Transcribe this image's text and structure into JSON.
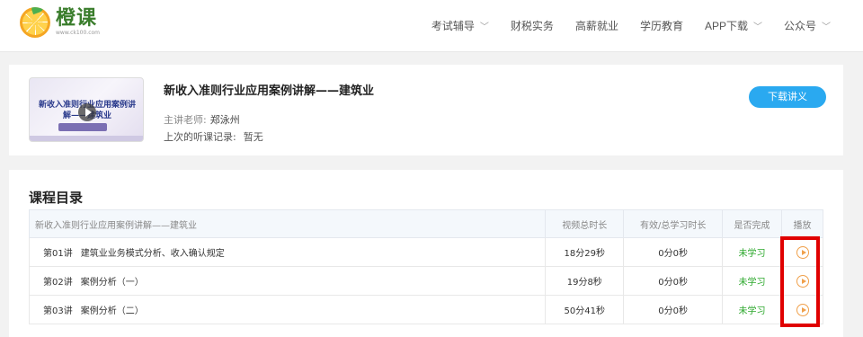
{
  "brand": {
    "name": "橙课",
    "url": "www.ck100.com"
  },
  "nav": [
    {
      "label": "考试辅导",
      "has_dropdown": true
    },
    {
      "label": "财税实务",
      "has_dropdown": false
    },
    {
      "label": "高薪就业",
      "has_dropdown": false
    },
    {
      "label": "学历教育",
      "has_dropdown": false
    },
    {
      "label": "APP下载",
      "has_dropdown": true
    },
    {
      "label": "公众号",
      "has_dropdown": true
    }
  ],
  "course": {
    "thumbnail_text": "新收入准则行业应用案例讲解——建筑业",
    "title": "新收入准则行业应用案例讲解——建筑业",
    "teacher_label": "主讲老师:",
    "teacher_name": "郑泳州",
    "last_record_label": "上次的听课记录:",
    "last_record_value": "暂无",
    "download_label": "下载讲义"
  },
  "catalog": {
    "title": "课程目录",
    "headers": {
      "name": "新收入准则行业应用案例讲解——建筑业",
      "duration": "视频总时长",
      "effective": "有效/总学习时长",
      "done": "是否完成",
      "play": "播放"
    },
    "rows": [
      {
        "no": "第01讲",
        "name": "建筑业业务模式分析、收入确认规定",
        "duration": "18分29秒",
        "effective": "0分0秒",
        "status": "未学习"
      },
      {
        "no": "第02讲",
        "name": "案例分析（一）",
        "duration": "19分8秒",
        "effective": "0分0秒",
        "status": "未学习"
      },
      {
        "no": "第03讲",
        "name": "案例分析（二）",
        "duration": "50分41秒",
        "effective": "0分0秒",
        "status": "未学习"
      }
    ]
  },
  "colors": {
    "accent": "#2aa9f0",
    "status_green": "#2ca82c",
    "play_orange": "#f0a04b",
    "highlight_red": "#e00000"
  }
}
